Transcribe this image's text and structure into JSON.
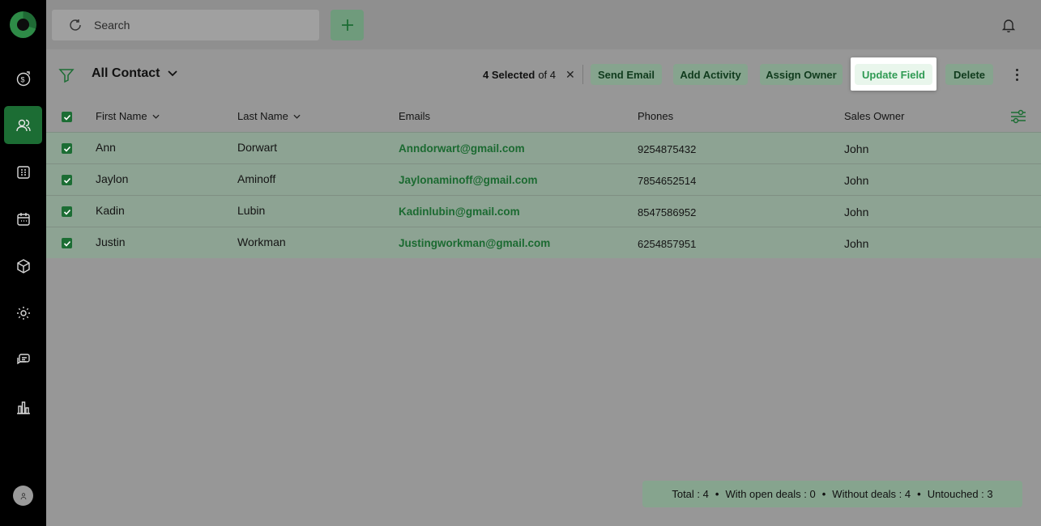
{
  "search": {
    "placeholder": "Search"
  },
  "view": {
    "title": "All Contact"
  },
  "selection": {
    "count_text": "4 Selected",
    "of_text": "of 4"
  },
  "actions": {
    "send_email": "Send Email",
    "add_activity": "Add Activity",
    "assign_owner": "Assign Owner",
    "update_field": "Update Field",
    "delete": "Delete"
  },
  "table": {
    "headers": {
      "first_name": "First Name",
      "last_name": "Last Name",
      "emails": "Emails",
      "phones": "Phones",
      "sales_owner": "Sales Owner"
    },
    "rows": [
      {
        "first": "Ann",
        "last": "Dorwart",
        "email": "Anndorwart@gmail.com",
        "phone": "9254875432",
        "owner": "John"
      },
      {
        "first": "Jaylon",
        "last": "Aminoff",
        "email": "Jaylonaminoff@gmail.com",
        "phone": "7854652514",
        "owner": "John"
      },
      {
        "first": "Kadin",
        "last": "Lubin",
        "email": "Kadinlubin@gmail.com",
        "phone": "8547586952",
        "owner": "John"
      },
      {
        "first": "Justin",
        "last": "Workman",
        "email": "Justingworkman@gmail.com",
        "phone": "6254857951",
        "owner": "John"
      }
    ]
  },
  "summary": {
    "total": "Total : 4",
    "open_deals": "With open deals : 0",
    "without_deals": "Without deals : 4",
    "untouched": "Untouched : 3"
  },
  "colors": {
    "accent": "#1c6d34",
    "highlight_text": "#2f9a53"
  }
}
